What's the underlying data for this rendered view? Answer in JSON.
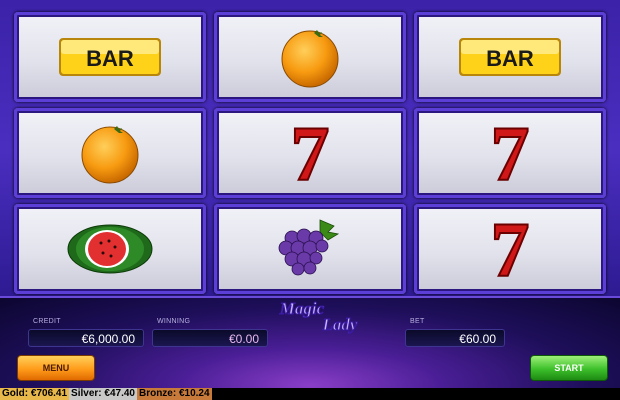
{
  "game": {
    "logo_line1": "Magic",
    "logo_line2": "Lady"
  },
  "reels": {
    "rows": [
      [
        "bar",
        "orange",
        "bar"
      ],
      [
        "orange",
        "seven",
        "seven"
      ],
      [
        "watermelon",
        "grapes",
        "seven"
      ]
    ],
    "bar_text": "BAR",
    "seven_text": "7"
  },
  "panel": {
    "credit_label": "CREDIT",
    "credit_value": "€6,000.00",
    "winning_label": "WINNING",
    "winning_value": "€0.00",
    "bet_label": "BET",
    "bet_value": "€60.00"
  },
  "buttons": {
    "menu": "MENU",
    "start": "START"
  },
  "jackpots": {
    "gold": "Gold: €706.41",
    "silver": "Silver: €47.40",
    "bronze": "Bronze: €10.24"
  },
  "colors": {
    "frame": "#4a2ec0",
    "seven": "#d01818",
    "bar_bg": "#ffd21a",
    "menu": "#ff9c1a",
    "start": "#3cc02a"
  }
}
